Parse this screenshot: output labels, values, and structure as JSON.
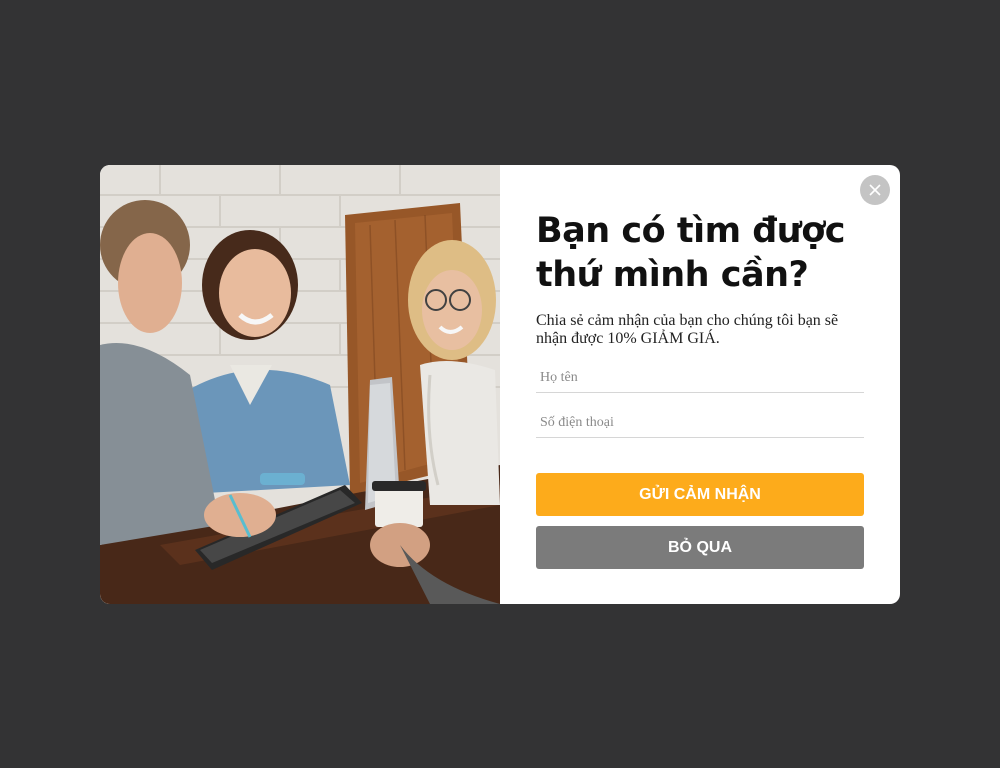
{
  "popup": {
    "title": "Bạn có tìm được thứ mình cần?",
    "subtitle": "Chia sẻ cảm nhận của bạn cho chúng tôi bạn sẽ nhận được 10% GIẢM GIÁ.",
    "fields": {
      "name_placeholder": "Họ tên",
      "phone_placeholder": "Số điện thoại"
    },
    "submit_label": "GỬI CẢM NHẬN",
    "skip_label": "BỎ QUA",
    "close_icon": "close-icon"
  },
  "colors": {
    "backdrop": "#333334",
    "submit_button": "#fdab1b",
    "skip_button": "#7b7b7b",
    "close_button": "#c4c4c4"
  }
}
